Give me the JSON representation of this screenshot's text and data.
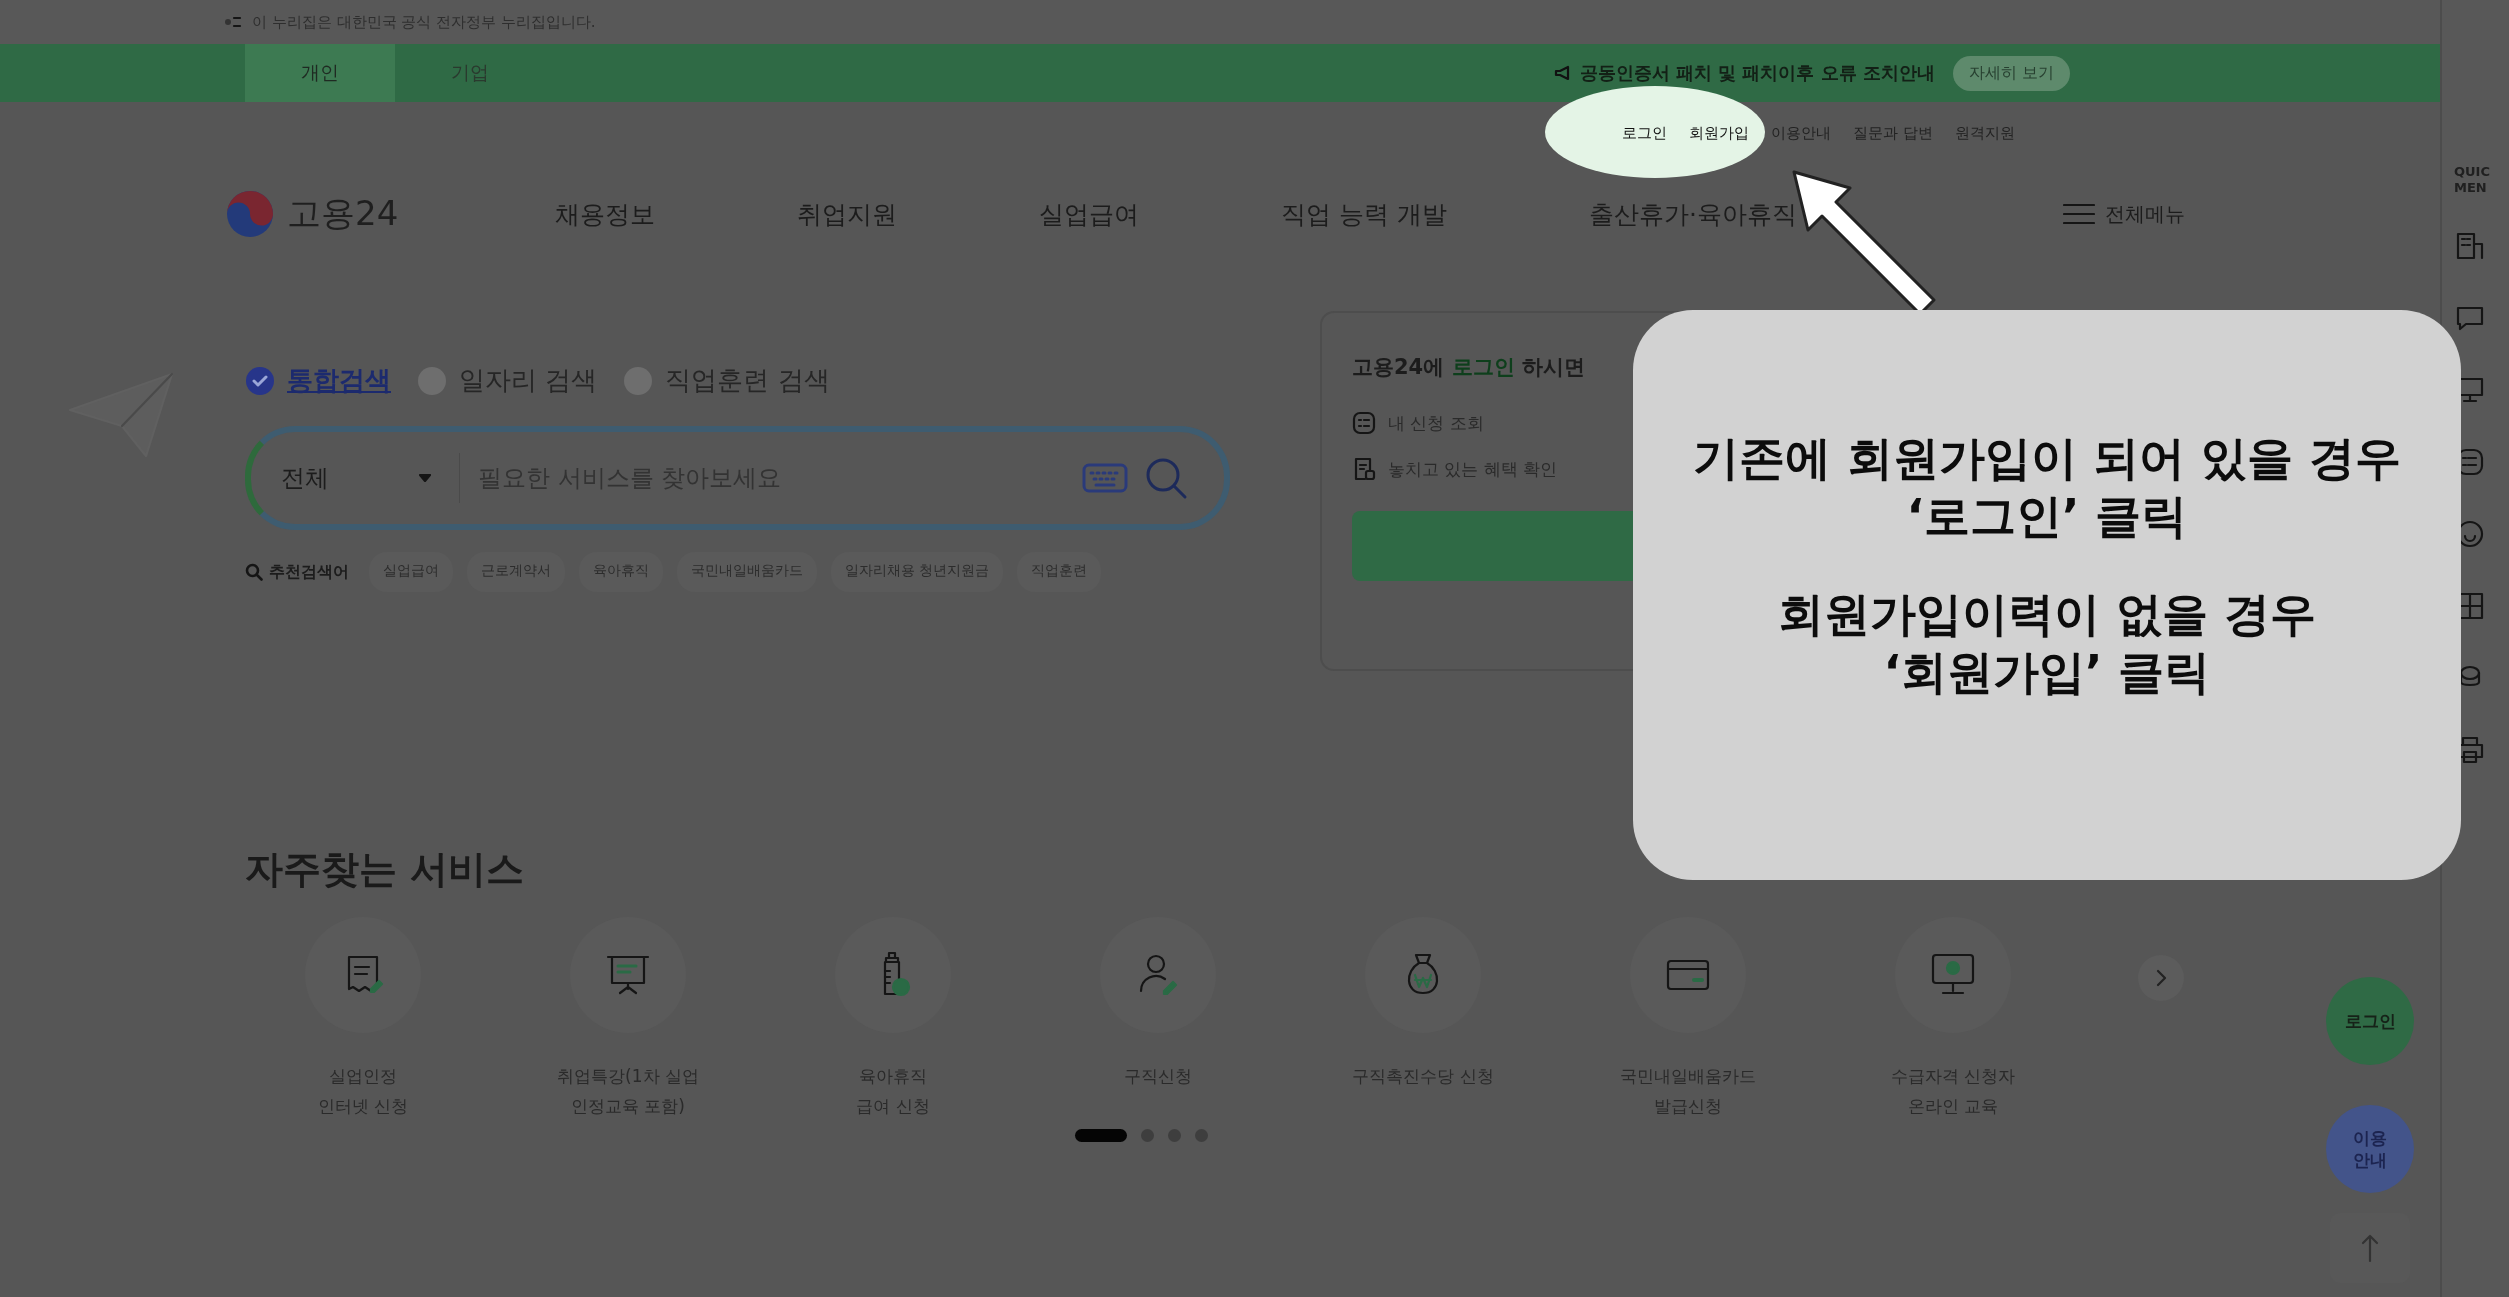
{
  "gov_banner": {
    "text": "이 누리집은 대한민국 공식 전자정부 누리집입니다."
  },
  "top_bar": {
    "tabs": [
      {
        "label": "개인",
        "selected": true
      },
      {
        "label": "기업",
        "selected": false
      }
    ],
    "notice": "공동인증서 패치 및 패치이후 오류 조치안내",
    "notice_button": "자세히 보기"
  },
  "util_links": [
    {
      "label": "로그인",
      "highlighted": true
    },
    {
      "label": "회원가입",
      "highlighted": true
    },
    {
      "label": "이용안내",
      "highlighted": false
    },
    {
      "label": "질문과 답변",
      "highlighted": false
    },
    {
      "label": "원격지원",
      "highlighted": false
    }
  ],
  "header": {
    "logo": "고용24",
    "nav": [
      "채용정보",
      "취업지원",
      "실업급여",
      "직업 능력 개발",
      "출산휴가·육아휴직"
    ],
    "all_menu": "전체메뉴"
  },
  "search": {
    "options": [
      {
        "label": "통합검색",
        "selected": true
      },
      {
        "label": "일자리 검색",
        "selected": false
      },
      {
        "label": "직업훈련 검색",
        "selected": false
      }
    ],
    "category": "전체",
    "placeholder": "필요한 서비스를 찾아보세요",
    "keywords_label": "추천검색어",
    "keywords": [
      "실업급여",
      "근로계약서",
      "육아휴직",
      "국민내일배움카드",
      "일자리채용 청년지원금",
      "직업훈련"
    ]
  },
  "login_panel": {
    "intro": "고용24에 **로그인** 하시면",
    "items": [
      {
        "label": "내 신청 조회",
        "kind": "list"
      },
      {
        "label": "놓치고 있는 혜택 확인",
        "kind": "doc"
      }
    ]
  },
  "callout": {
    "paragraphs": [
      "기존에 회원가입이 되어 있을 경우\n‘로그인’ 클릭",
      "회원가입이력이 없을 경우\n‘회원가입’ 클릭"
    ]
  },
  "services": {
    "title": "자주찾는 서비스",
    "items": [
      {
        "label": "실업인정\n인터넷 신청",
        "kind": "receipt"
      },
      {
        "label": "취업특강(1차 실업\n인정교육 포함)",
        "kind": "board"
      },
      {
        "label": "육아휴직\n급여 신청",
        "kind": "bottle"
      },
      {
        "label": "구직신청",
        "kind": "person"
      },
      {
        "label": "구직촉진수당 신청",
        "kind": "moneybag"
      },
      {
        "label": "국민내일배움카드\n발급신청",
        "kind": "card"
      },
      {
        "label": "수급자격 신청자\n온라인 교육",
        "kind": "monitor"
      }
    ],
    "pager": [
      {
        "selected": true
      },
      {
        "selected": false
      },
      {
        "selected": false
      },
      {
        "selected": false
      }
    ]
  },
  "floating": [
    {
      "label": "로그인",
      "color": "#2f6a45"
    },
    {
      "label": "이용\n안내",
      "color": "#43548a"
    }
  ],
  "quick_menu": {
    "label": "QUIC\nMEN",
    "icons": [
      {
        "kind": "building"
      },
      {
        "kind": "chat"
      },
      {
        "kind": "monitor"
      },
      {
        "kind": "list"
      },
      {
        "kind": "smile"
      },
      {
        "kind": "grid"
      },
      {
        "kind": "coins"
      },
      {
        "kind": "printer"
      }
    ]
  }
}
